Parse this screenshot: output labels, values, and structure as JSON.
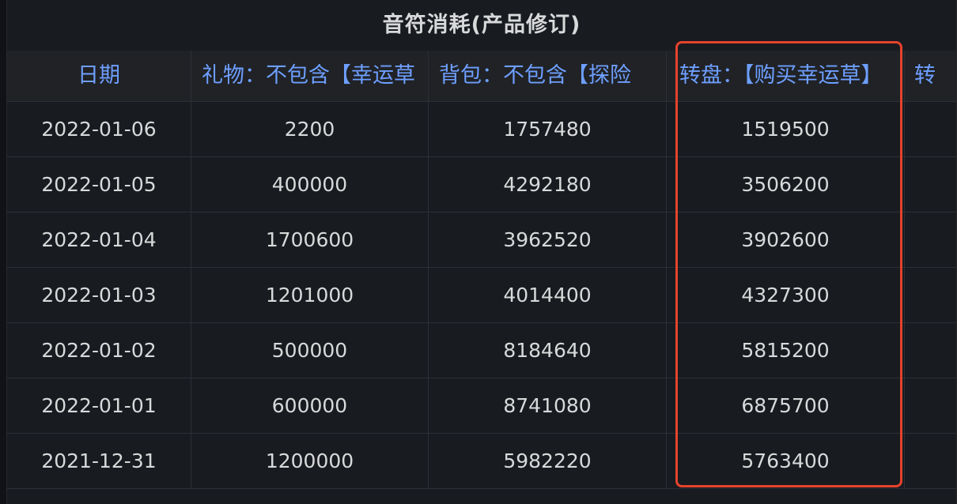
{
  "panel": {
    "title": "音符消耗(产品修订)"
  },
  "table": {
    "columns": [
      "日期",
      "礼物：不包含【幸运草",
      "背包：不包含【探险",
      "转盘：【购买幸运草】",
      "转"
    ],
    "rows": [
      [
        "2022-01-06",
        "2200",
        "1757480",
        "1519500"
      ],
      [
        "2022-01-05",
        "400000",
        "4292180",
        "3506200"
      ],
      [
        "2022-01-04",
        "1700600",
        "3962520",
        "3902600"
      ],
      [
        "2022-01-03",
        "1201000",
        "4014400",
        "4327300"
      ],
      [
        "2022-01-02",
        "500000",
        "8184640",
        "5815200"
      ],
      [
        "2022-01-01",
        "600000",
        "8741080",
        "6875700"
      ],
      [
        "2021-12-31",
        "1200000",
        "5982220",
        "5763400"
      ]
    ]
  },
  "colors": {
    "header_text": "#6e9fff",
    "highlight_border": "#e5432d",
    "panel_bg": "#181b1f"
  }
}
